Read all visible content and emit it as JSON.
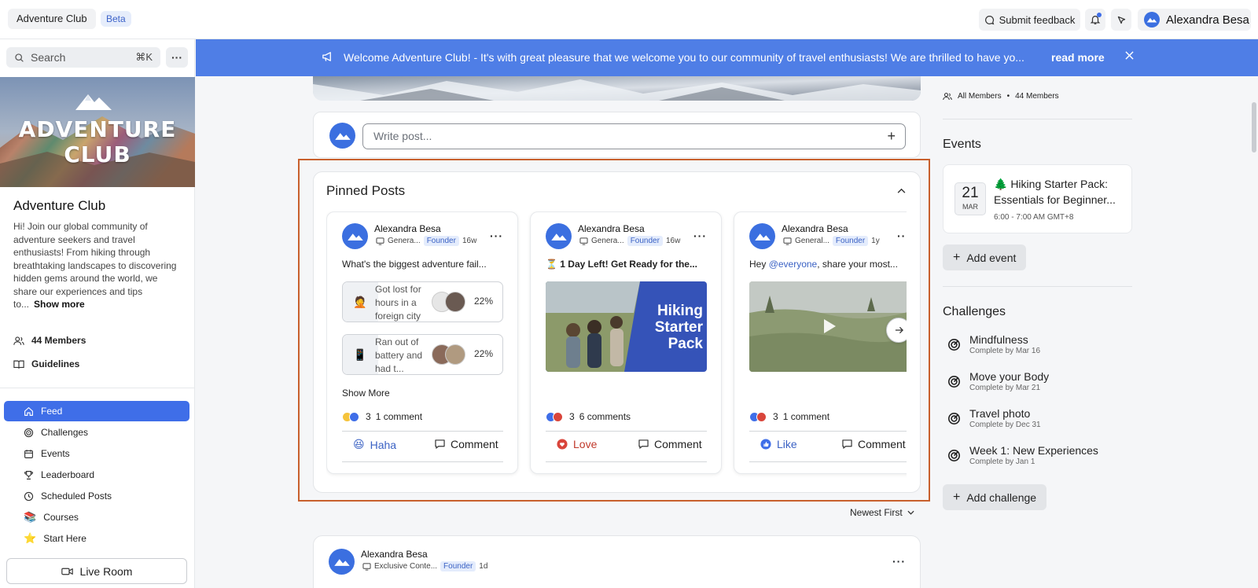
{
  "topbar": {
    "club": "Adventure Club",
    "beta": "Beta",
    "feedback": "Submit feedback",
    "user": "Alexandra Besa"
  },
  "sidebar": {
    "search_placeholder": "Search",
    "search_shortcut": "⌘K",
    "cover_line1": "ADVENTURE",
    "cover_line2": "CLUB",
    "club_name": "Adventure Club",
    "description": "Hi! Join our global community of adventure seekers and travel enthusiasts! From hiking through breathtaking landscapes to discovering hidden gems around the world, we share our experiences and tips to...",
    "show_more": "Show more",
    "members": "44 Members",
    "guidelines": "Guidelines",
    "nav": [
      "Feed",
      "Challenges",
      "Events",
      "Leaderboard",
      "Scheduled Posts",
      "Courses",
      "Start Here"
    ],
    "live_room": "Live Room"
  },
  "banner": {
    "text": "Welcome Adventure Club! - It's with great pleasure that we welcome you to our community of travel enthusiasts! We are thrilled to have yo...",
    "read_more": "read more"
  },
  "composer": {
    "placeholder": "Write post..."
  },
  "pinned": {
    "title": "Pinned Posts",
    "posts": [
      {
        "author": "Alexandra Besa",
        "channel": "Genera...",
        "badge": "Founder",
        "time": "16w",
        "text": "What's the biggest adventure fail...",
        "poll": [
          {
            "emoji": "🤦",
            "label": "Got lost for hours in a foreign city",
            "pct": "22%",
            "pct_value": 22
          },
          {
            "emoji": "📱",
            "label": "Ran out of battery and had t...",
            "pct": "22%",
            "pct_value": 22
          }
        ],
        "show_more": "Show More",
        "reaction_count": "3",
        "comments": "1 comment",
        "reaction_label": "Haha",
        "comment_label": "Comment"
      },
      {
        "author": "Alexandra Besa",
        "channel": "Genera...",
        "badge": "Founder",
        "time": "16w",
        "text": "⏳ 1 Day Left! Get Ready for the...",
        "image_text": "Hiking Starter Pack",
        "reaction_count": "3",
        "comments": "6 comments",
        "reaction_label": "Love",
        "comment_label": "Comment"
      },
      {
        "author": "Alexandra Besa",
        "channel": "General...",
        "badge": "Founder",
        "time": "1y",
        "text_prefix": "Hey ",
        "mention": "@everyone",
        "text_suffix": ", share your most...",
        "reaction_count": "3",
        "comments": "1 comment",
        "reaction_label": "Like",
        "comment_label": "Comment"
      }
    ]
  },
  "sort": "Newest First",
  "feed_post": {
    "author": "Alexandra Besa",
    "channel": "Exclusive Conte...",
    "badge": "Founder",
    "time": "1d"
  },
  "right": {
    "all_members": "All Members",
    "member_count": "44 Members",
    "events_heading": "Events",
    "event": {
      "day": "21",
      "month": "MAR",
      "title": "🌲 Hiking Starter Pack: Essentials for Beginner...",
      "time": "6:00 - 7:00 AM GMT+8"
    },
    "add_event": "Add event",
    "challenges_heading": "Challenges",
    "challenges": [
      {
        "name": "Mindfulness",
        "due": "Complete by Mar 16"
      },
      {
        "name": "Move your Body",
        "due": "Complete by Mar 21"
      },
      {
        "name": "Travel photo",
        "due": "Complete by Dec 31"
      },
      {
        "name": "Week 1: New Experiences",
        "due": "Complete by Jan 1"
      }
    ],
    "add_challenge": "Add challenge"
  },
  "colors": {
    "accent": "#3f6ee8",
    "banner": "#4f7ee6",
    "highlight_outline": "#c8602d"
  }
}
